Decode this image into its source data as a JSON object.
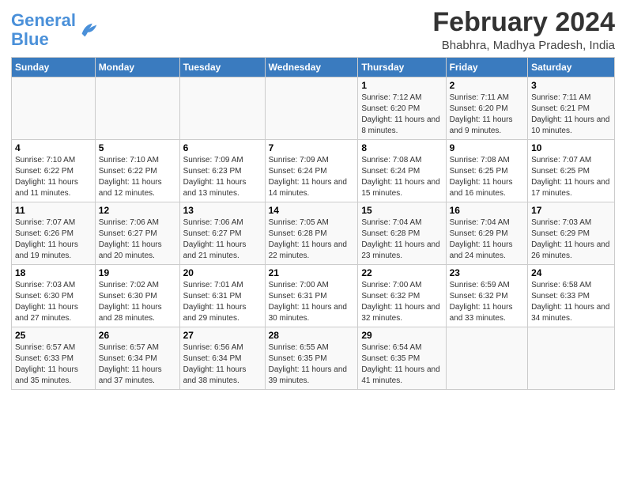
{
  "logo": {
    "text1": "General",
    "text2": "Blue"
  },
  "title": "February 2024",
  "subtitle": "Bhabhra, Madhya Pradesh, India",
  "days_of_week": [
    "Sunday",
    "Monday",
    "Tuesday",
    "Wednesday",
    "Thursday",
    "Friday",
    "Saturday"
  ],
  "weeks": [
    [
      {
        "day": "",
        "info": ""
      },
      {
        "day": "",
        "info": ""
      },
      {
        "day": "",
        "info": ""
      },
      {
        "day": "",
        "info": ""
      },
      {
        "day": "1",
        "info": "Sunrise: 7:12 AM\nSunset: 6:20 PM\nDaylight: 11 hours and 8 minutes."
      },
      {
        "day": "2",
        "info": "Sunrise: 7:11 AM\nSunset: 6:20 PM\nDaylight: 11 hours and 9 minutes."
      },
      {
        "day": "3",
        "info": "Sunrise: 7:11 AM\nSunset: 6:21 PM\nDaylight: 11 hours and 10 minutes."
      }
    ],
    [
      {
        "day": "4",
        "info": "Sunrise: 7:10 AM\nSunset: 6:22 PM\nDaylight: 11 hours and 11 minutes."
      },
      {
        "day": "5",
        "info": "Sunrise: 7:10 AM\nSunset: 6:22 PM\nDaylight: 11 hours and 12 minutes."
      },
      {
        "day": "6",
        "info": "Sunrise: 7:09 AM\nSunset: 6:23 PM\nDaylight: 11 hours and 13 minutes."
      },
      {
        "day": "7",
        "info": "Sunrise: 7:09 AM\nSunset: 6:24 PM\nDaylight: 11 hours and 14 minutes."
      },
      {
        "day": "8",
        "info": "Sunrise: 7:08 AM\nSunset: 6:24 PM\nDaylight: 11 hours and 15 minutes."
      },
      {
        "day": "9",
        "info": "Sunrise: 7:08 AM\nSunset: 6:25 PM\nDaylight: 11 hours and 16 minutes."
      },
      {
        "day": "10",
        "info": "Sunrise: 7:07 AM\nSunset: 6:25 PM\nDaylight: 11 hours and 17 minutes."
      }
    ],
    [
      {
        "day": "11",
        "info": "Sunrise: 7:07 AM\nSunset: 6:26 PM\nDaylight: 11 hours and 19 minutes."
      },
      {
        "day": "12",
        "info": "Sunrise: 7:06 AM\nSunset: 6:27 PM\nDaylight: 11 hours and 20 minutes."
      },
      {
        "day": "13",
        "info": "Sunrise: 7:06 AM\nSunset: 6:27 PM\nDaylight: 11 hours and 21 minutes."
      },
      {
        "day": "14",
        "info": "Sunrise: 7:05 AM\nSunset: 6:28 PM\nDaylight: 11 hours and 22 minutes."
      },
      {
        "day": "15",
        "info": "Sunrise: 7:04 AM\nSunset: 6:28 PM\nDaylight: 11 hours and 23 minutes."
      },
      {
        "day": "16",
        "info": "Sunrise: 7:04 AM\nSunset: 6:29 PM\nDaylight: 11 hours and 24 minutes."
      },
      {
        "day": "17",
        "info": "Sunrise: 7:03 AM\nSunset: 6:29 PM\nDaylight: 11 hours and 26 minutes."
      }
    ],
    [
      {
        "day": "18",
        "info": "Sunrise: 7:03 AM\nSunset: 6:30 PM\nDaylight: 11 hours and 27 minutes."
      },
      {
        "day": "19",
        "info": "Sunrise: 7:02 AM\nSunset: 6:30 PM\nDaylight: 11 hours and 28 minutes."
      },
      {
        "day": "20",
        "info": "Sunrise: 7:01 AM\nSunset: 6:31 PM\nDaylight: 11 hours and 29 minutes."
      },
      {
        "day": "21",
        "info": "Sunrise: 7:00 AM\nSunset: 6:31 PM\nDaylight: 11 hours and 30 minutes."
      },
      {
        "day": "22",
        "info": "Sunrise: 7:00 AM\nSunset: 6:32 PM\nDaylight: 11 hours and 32 minutes."
      },
      {
        "day": "23",
        "info": "Sunrise: 6:59 AM\nSunset: 6:32 PM\nDaylight: 11 hours and 33 minutes."
      },
      {
        "day": "24",
        "info": "Sunrise: 6:58 AM\nSunset: 6:33 PM\nDaylight: 11 hours and 34 minutes."
      }
    ],
    [
      {
        "day": "25",
        "info": "Sunrise: 6:57 AM\nSunset: 6:33 PM\nDaylight: 11 hours and 35 minutes."
      },
      {
        "day": "26",
        "info": "Sunrise: 6:57 AM\nSunset: 6:34 PM\nDaylight: 11 hours and 37 minutes."
      },
      {
        "day": "27",
        "info": "Sunrise: 6:56 AM\nSunset: 6:34 PM\nDaylight: 11 hours and 38 minutes."
      },
      {
        "day": "28",
        "info": "Sunrise: 6:55 AM\nSunset: 6:35 PM\nDaylight: 11 hours and 39 minutes."
      },
      {
        "day": "29",
        "info": "Sunrise: 6:54 AM\nSunset: 6:35 PM\nDaylight: 11 hours and 41 minutes."
      },
      {
        "day": "",
        "info": ""
      },
      {
        "day": "",
        "info": ""
      }
    ]
  ]
}
